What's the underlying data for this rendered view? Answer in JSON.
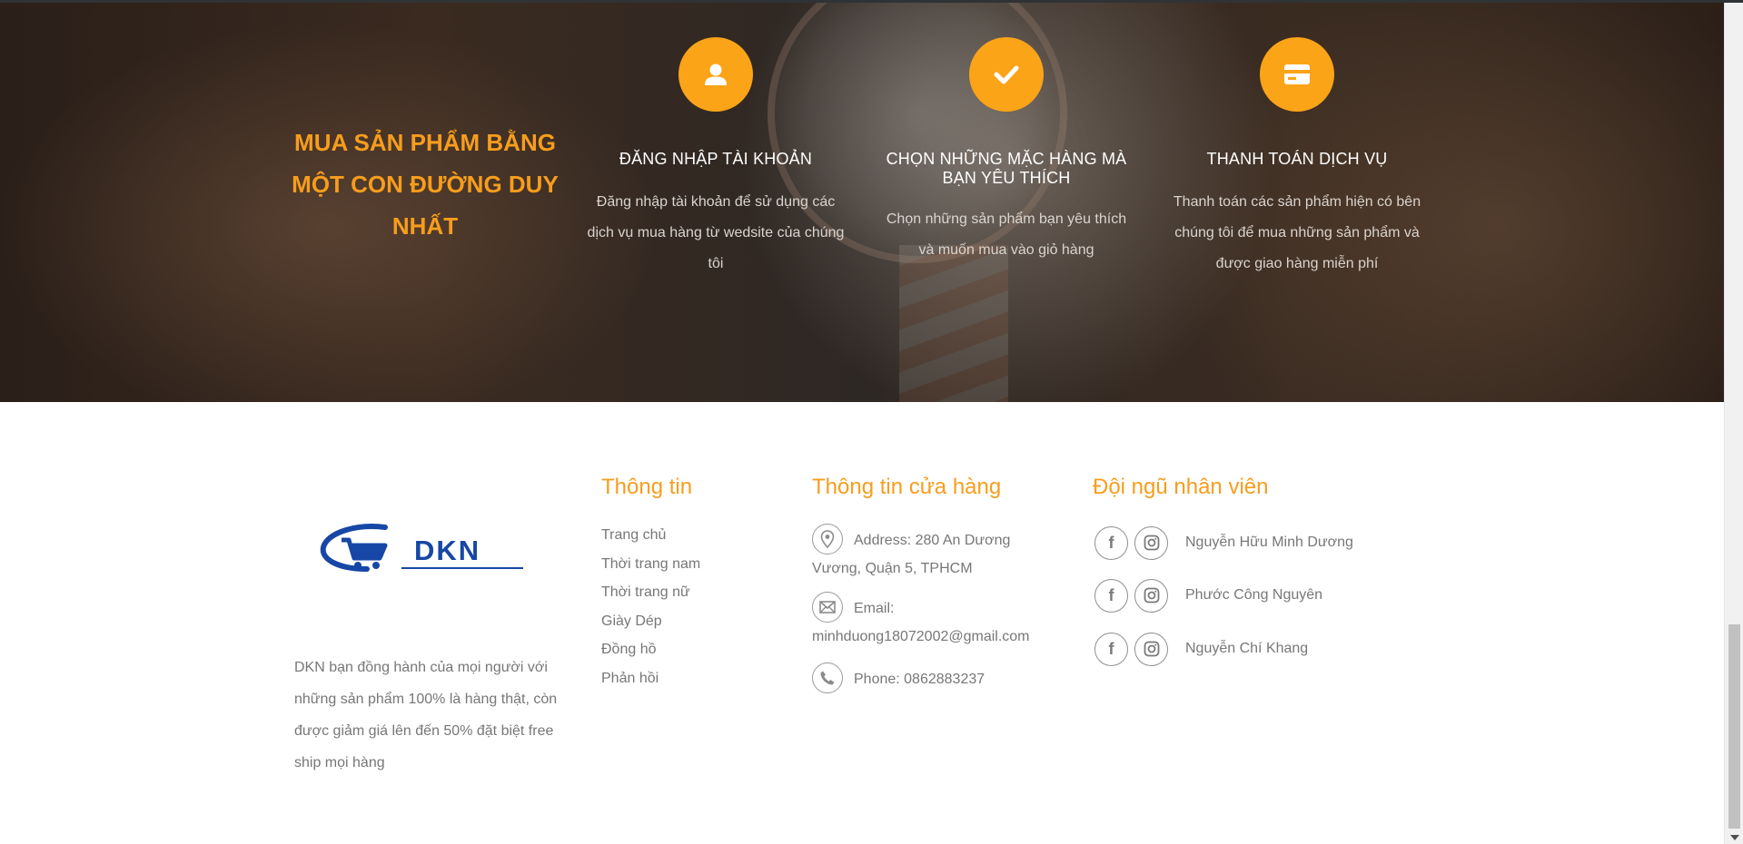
{
  "hero": {
    "title": "MUA SẢN PHẨM BẰNG MỘT CON ĐƯỜNG DUY NHẤT",
    "accent_color": "#f79d1c",
    "steps": [
      {
        "icon": "user-icon",
        "heading": "ĐĂNG NHẬP TÀI KHOẢN",
        "description": "Đăng nhập tài khoản để sử dụng các dịch vụ mua hàng từ wedsite của chúng tôi"
      },
      {
        "icon": "checkmark-icon",
        "heading": "CHỌN NHỮNG MẶC HÀNG MÀ BẠN YÊU THÍCH",
        "description": "Chọn những sản phẩm bạn yêu thích và muốn mua vào giỏ hàng"
      },
      {
        "icon": "credit-card-icon",
        "heading": "THANH TOÁN DỊCH VỤ",
        "description": "Thanh toán các sản phẩm hiện có bên chúng tôi để mua những sản phẩm và được giao hàng miễn phí"
      }
    ]
  },
  "footer": {
    "logo_text": "DKN",
    "brand_color": "#1747a6",
    "about": "DKN bạn đồng hành của mọi người với những sản phẩm 100% là hàng thật, còn được giảm giá lên đến 50% đặt biệt free ship mọi hàng",
    "info": {
      "title": "Thông tin",
      "links": [
        "Trang chủ",
        "Thời trang nam",
        "Thời trang nữ",
        "Giày Dép",
        "Đồng hồ",
        "Phản hồi"
      ]
    },
    "store": {
      "title": "Thông tin cửa hàng",
      "address": "Address: 280 An Dương Vương, Quận 5, TPHCM",
      "email": "Email: minhduong18072002@gmail.com",
      "phone": "Phone: 0862883237"
    },
    "team": {
      "title": "Đội ngũ nhân viên",
      "members": [
        {
          "name": "Nguyễn Hữu Minh Dương",
          "icons": [
            "facebook-icon",
            "instagram-icon"
          ]
        },
        {
          "name": "Phước Công Nguyên",
          "icons": [
            "facebook-icon",
            "instagram-icon"
          ]
        },
        {
          "name": "Nguyễn Chí Khang",
          "icons": [
            "facebook-icon",
            "instagram-icon"
          ]
        }
      ]
    }
  }
}
